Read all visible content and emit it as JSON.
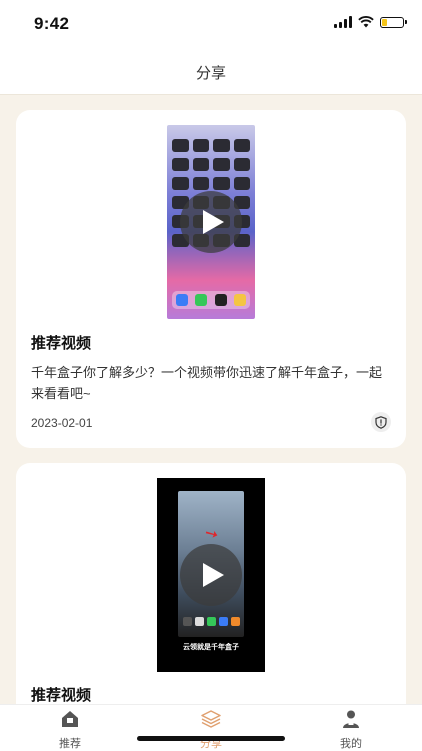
{
  "status_bar": {
    "time": "9:42",
    "battery_level": 0.2,
    "battery_color": "#f5c518"
  },
  "header": {
    "title": "分享"
  },
  "feed": {
    "cards": [
      {
        "title": "推荐视频",
        "description": "千年盒子你了解多少？一个视频带你迅速了解千年盒子，一起来看看吧~",
        "date": "2023-02-01"
      },
      {
        "title": "推荐视频",
        "video_caption": "云领就是千年盒子"
      }
    ]
  },
  "tabbar": {
    "items": [
      {
        "label": "推荐",
        "icon": "home-icon",
        "active": false
      },
      {
        "label": "分享",
        "icon": "layers-icon",
        "active": true
      },
      {
        "label": "我的",
        "icon": "user-icon",
        "active": false
      }
    ],
    "active_color": "#e0a070"
  }
}
